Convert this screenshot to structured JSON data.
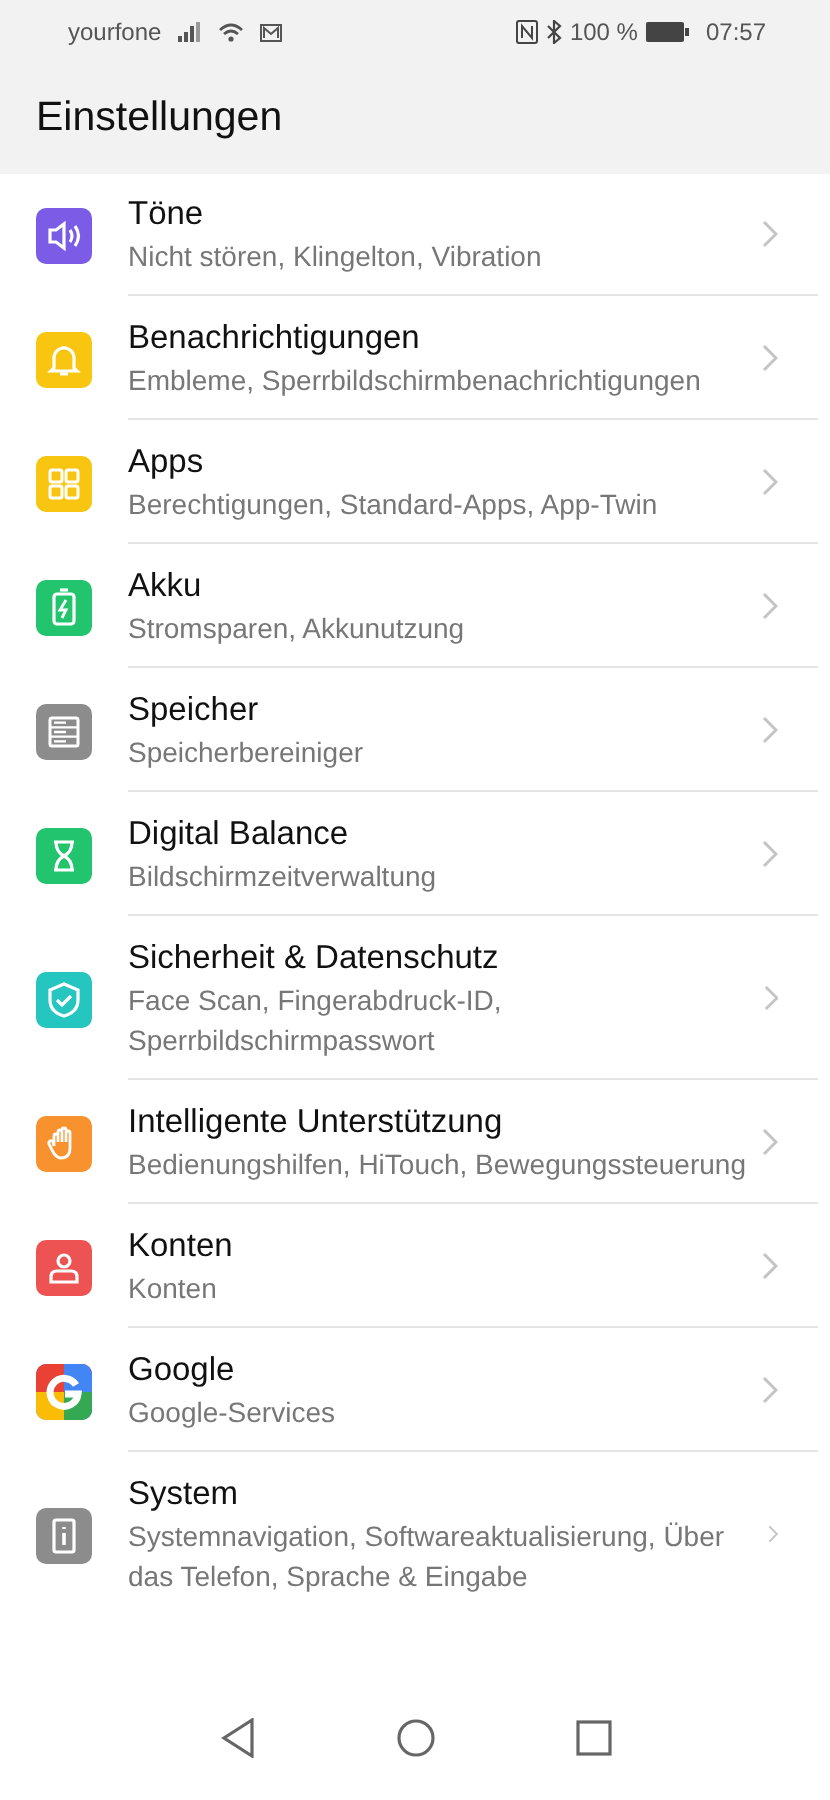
{
  "status_bar": {
    "carrier": "yourfone",
    "battery": "100 %",
    "time": "07:57"
  },
  "title": "Einstellungen",
  "items": [
    {
      "kind": "sound",
      "color": "#7b5ce6",
      "title": "Töne",
      "subtitle": "Nicht stören, Klingelton, Vibration"
    },
    {
      "kind": "bell",
      "color": "#f8c511",
      "title": "Benachrichtigungen",
      "subtitle": "Embleme, Sperrbildschirmbenachrichtigungen"
    },
    {
      "kind": "grid",
      "color": "#f8c511",
      "title": "Apps",
      "subtitle": "Berechtigungen, Standard-Apps, App-Twin"
    },
    {
      "kind": "battery",
      "color": "#22c46e",
      "title": "Akku",
      "subtitle": "Stromsparen, Akkunutzung"
    },
    {
      "kind": "storage",
      "color": "#8c8c8c",
      "title": "Speicher",
      "subtitle": "Speicherbereiniger"
    },
    {
      "kind": "hourglass",
      "color": "#22c46e",
      "title": "Digital Balance",
      "subtitle": "Bildschirmzeitverwaltung"
    },
    {
      "kind": "shield",
      "color": "#26c6c0",
      "title": "Sicherheit & Datenschutz",
      "subtitle": "Face Scan, Fingerabdruck-ID, Sperrbildschirmpasswort"
    },
    {
      "kind": "hand",
      "color": "#f7922e",
      "title": "Intelligente Unterstützung",
      "subtitle": "Bedienungshilfen, HiTouch, Bewegungssteuerung"
    },
    {
      "kind": "person",
      "color": "#ee5353",
      "title": "Konten",
      "subtitle": "Konten"
    },
    {
      "kind": "multicolor",
      "color": "#4285f4",
      "title": "Google",
      "subtitle": "Google-Services"
    },
    {
      "kind": "info",
      "color": "#8c8c8c",
      "title": "System",
      "subtitle": "Systemnavigation, Softwareaktualisierung, Über das Telefon, Sprache & Eingabe"
    }
  ]
}
